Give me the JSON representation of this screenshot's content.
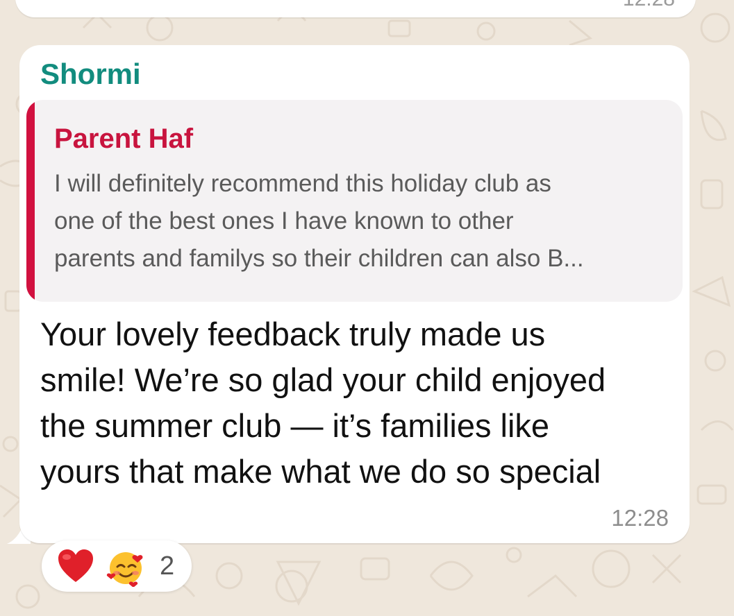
{
  "previous_message": {
    "time": "12:28"
  },
  "message": {
    "sender": "Shormi",
    "quote": {
      "author": "Parent Haf",
      "lines": [
        "I will definitely recommend this holiday club as",
        "one of the best ones I have known to other",
        "parents and familys so their children can also B..."
      ]
    },
    "body_lines": [
      "Your lovely feedback truly made us",
      "smile! We’re so glad your child enjoyed",
      "the summer club — it’s families like",
      "yours that make what we do so special"
    ],
    "time": "12:28"
  },
  "reactions": {
    "emojis": [
      "red-heart-icon",
      "smiling-face-with-hearts-icon"
    ],
    "count": "2"
  },
  "colors": {
    "sender": "#128c7e",
    "quote_author": "#c8143e",
    "quote_bar": "#d1113f",
    "wallpaper": "#efe7dc"
  }
}
